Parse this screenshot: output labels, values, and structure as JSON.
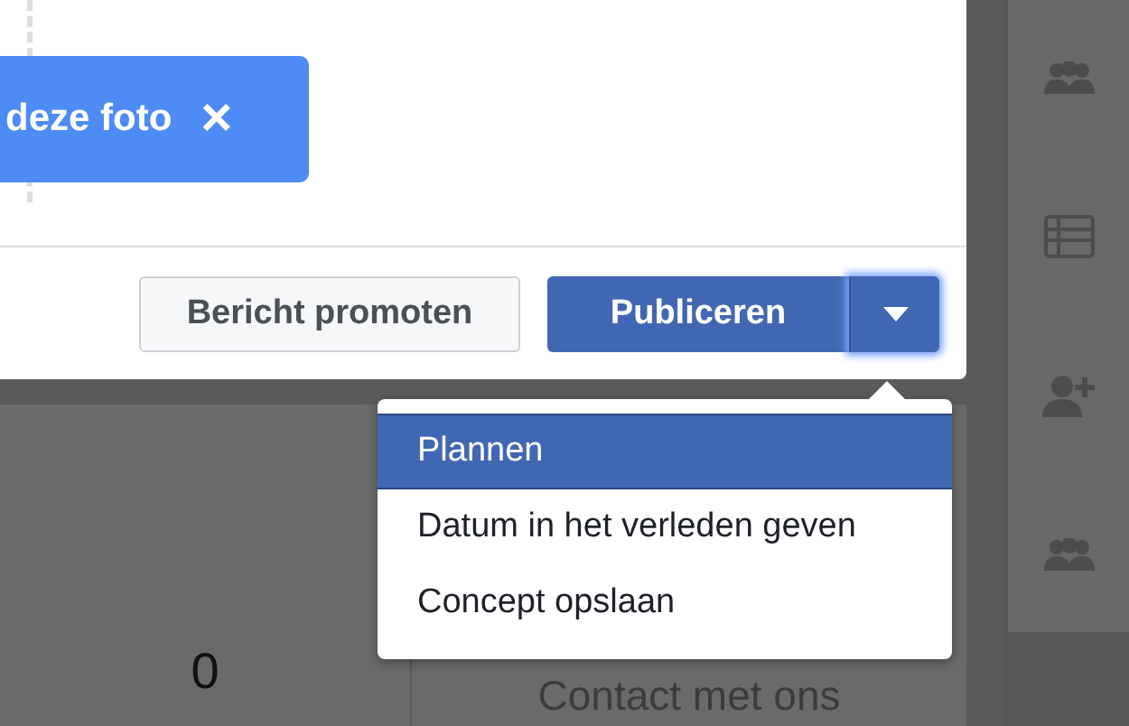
{
  "dialog": {
    "tag": {
      "label": "deze foto",
      "close": "×"
    },
    "promote_button": "Bericht promoten",
    "publish_button": "Publiceren"
  },
  "menu": {
    "items": [
      {
        "label": "Plannen",
        "selected": true
      },
      {
        "label": "Datum in het verleden geven",
        "selected": false
      },
      {
        "label": "Concept opslaan",
        "selected": false
      }
    ]
  },
  "stats": [
    {
      "value": "0"
    },
    {
      "label": "Contact met ons"
    }
  ],
  "sidebar": {
    "items": [
      {
        "kind": "group"
      },
      {
        "kind": "list"
      },
      {
        "kind": "add-person"
      },
      {
        "kind": "group"
      }
    ]
  }
}
